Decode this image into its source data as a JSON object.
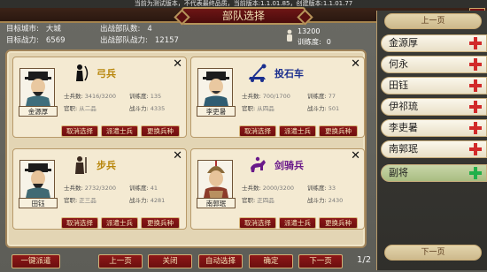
{
  "notice": "当前为测试版本，不代表最终品质，当前版本:1.1.01.85，创建版本:1.1.01.77",
  "title": "部队选择",
  "close_glyph": "✕",
  "stats": {
    "city_label": "目标城市:",
    "city_value": "大城",
    "power_label": "目标战力:",
    "power_value": "6569",
    "troops_label": "出战部队数:",
    "troops_value": "4",
    "troop_power_label": "出战部队战力:",
    "troop_power_value": "12157",
    "resource_value": "13200",
    "training_label": "训练度:",
    "training_value": "0"
  },
  "cards": [
    {
      "general": "金源厚",
      "unit": "弓兵",
      "unit_icon": "archer-icon",
      "unit_color": "gold",
      "soldiers_label": "士兵数:",
      "soldiers": "3416/3200",
      "train_label": "训练度:",
      "train": "135",
      "rank_label": "官职:",
      "rank": "从二品",
      "power_label": "战斗力:",
      "power": "4335"
    },
    {
      "general": "李吏暑",
      "unit": "投石车",
      "unit_icon": "catapult-icon",
      "unit_color": "blue",
      "soldiers_label": "士兵数:",
      "soldiers": "700/1700",
      "train_label": "训练度:",
      "train": "77",
      "rank_label": "官职:",
      "rank": "从四品",
      "power_label": "战斗力:",
      "power": "501"
    },
    {
      "general": "田钰",
      "unit": "步兵",
      "unit_icon": "infantry-icon",
      "unit_color": "gold",
      "soldiers_label": "士兵数:",
      "soldiers": "2732/3200",
      "train_label": "训练度:",
      "train": "41",
      "rank_label": "官职:",
      "rank": "正三品",
      "power_label": "战斗力:",
      "power": "4281"
    },
    {
      "general": "南郭珉",
      "unit": "剑骑兵",
      "unit_icon": "cavalry-icon",
      "unit_color": "purple",
      "soldiers_label": "士兵数:",
      "soldiers": "2000/3200",
      "train_label": "训练度:",
      "train": "33",
      "rank_label": "官职:",
      "rank": "正四品",
      "power_label": "战斗力:",
      "power": "2430"
    }
  ],
  "card_buttons": {
    "cancel": "取消选择",
    "dispatch": "派遣士兵",
    "change": "更换兵种"
  },
  "side": {
    "prev": "上一页",
    "next": "下一页",
    "items": [
      {
        "label": "金源厚",
        "icon": "plus-icon"
      },
      {
        "label": "何永",
        "icon": "plus-icon"
      },
      {
        "label": "田钰",
        "icon": "plus-icon"
      },
      {
        "label": "伊祁琉",
        "icon": "plus-icon"
      },
      {
        "label": "李吏暑",
        "icon": "plus-icon"
      },
      {
        "label": "南郭珉",
        "icon": "plus-icon"
      },
      {
        "label": "副将",
        "icon": "plus-icon"
      }
    ]
  },
  "bottom": {
    "dispatch_all": "一键派遣",
    "prev": "上一页",
    "close": "关闭",
    "auto": "自动选择",
    "confirm": "确定",
    "next": "下一页",
    "page": "1/2"
  },
  "colors": {
    "panel_red": "#7a1212",
    "gold": "#b8860b",
    "purple": "#6a1a8a",
    "plus_red": "#d12a2a",
    "plus_green": "#22b04a"
  }
}
